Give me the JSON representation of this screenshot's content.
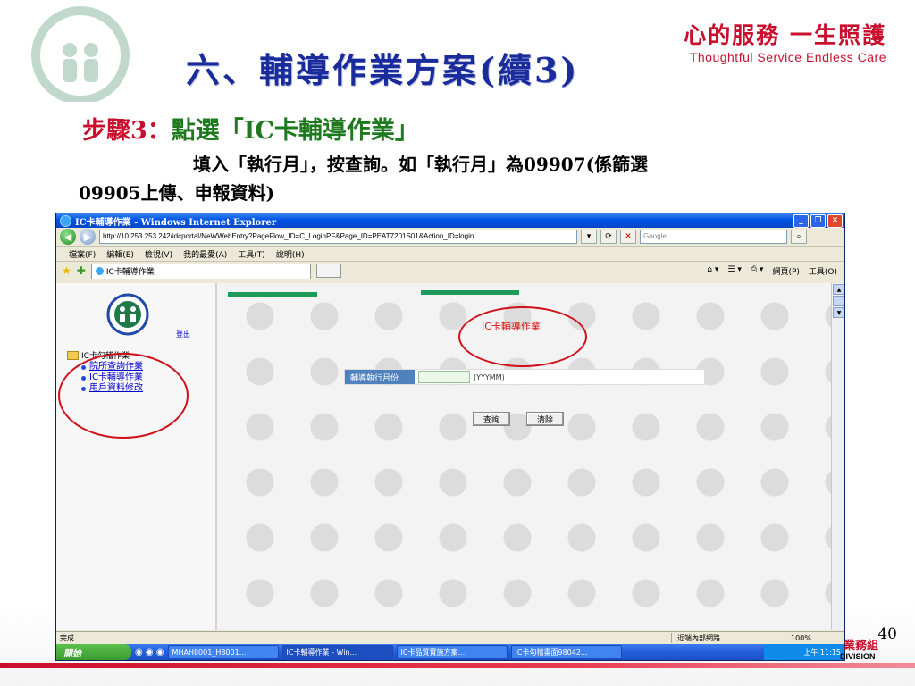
{
  "slide": {
    "slogan_cn": "心的服務 一生照護",
    "slogan_en": "Thoughtful Service Endless Care",
    "title": "六、輔導作業方案(續3)",
    "step_label": "步驟3：",
    "step_name": "點選「IC卡輔導作業」",
    "desc_line1": "填入「執行月」，按查詢。如「執行月」為09907(係篩選",
    "desc_line2": "09905上傳、申報資料)",
    "page_number": "40",
    "footer_cn": "業務組",
    "footer_en": "DIVISION",
    "colors": {
      "title": "#1a2c9b",
      "step_label": "#c8102e",
      "step_name": "#1f7a1f",
      "accent_red": "#c8102e"
    }
  },
  "browser": {
    "title": "IC卡輔導作業 - Windows Internet Explorer",
    "address": "http://10.253.253.242/idcportal/NeWWebEntry?PageFlow_ID=C_LoginPF&Page_ID=PEAT7201S01&Action_ID=login",
    "search_placeholder": "Google",
    "menu": [
      "檔案(F)",
      "編輯(E)",
      "檢視(V)",
      "我的最愛(A)",
      "工具(T)",
      "說明(H)"
    ],
    "tab_label": "IC卡輔導作業",
    "toolbar_right": [
      "網頁(P)",
      "工具(O)"
    ],
    "status_left": "完成",
    "status_zone": "近端內部網路",
    "status_zoom": "100%"
  },
  "sidebar": {
    "logout": "登出",
    "tree_root": "IC卡勾稽作業",
    "items": [
      {
        "label": "院所查詢作業"
      },
      {
        "label": "IC卡輔導作業"
      },
      {
        "label": "用戶資料修改"
      }
    ]
  },
  "form": {
    "title": "IC卡輔導作業",
    "field_label": "輔導執行月份",
    "field_value": "",
    "field_hint": "(YYYMM)",
    "query_button": "查詢",
    "clear_button": "清除"
  },
  "taskbar": {
    "start": "開始",
    "tasks": [
      "MHAH8001_H8001...",
      "IC卡輔導作業 - Win...",
      "IC卡品質實施方案...",
      "IC卡勾稽畫面98042..."
    ],
    "clock": "上午 11:15"
  }
}
